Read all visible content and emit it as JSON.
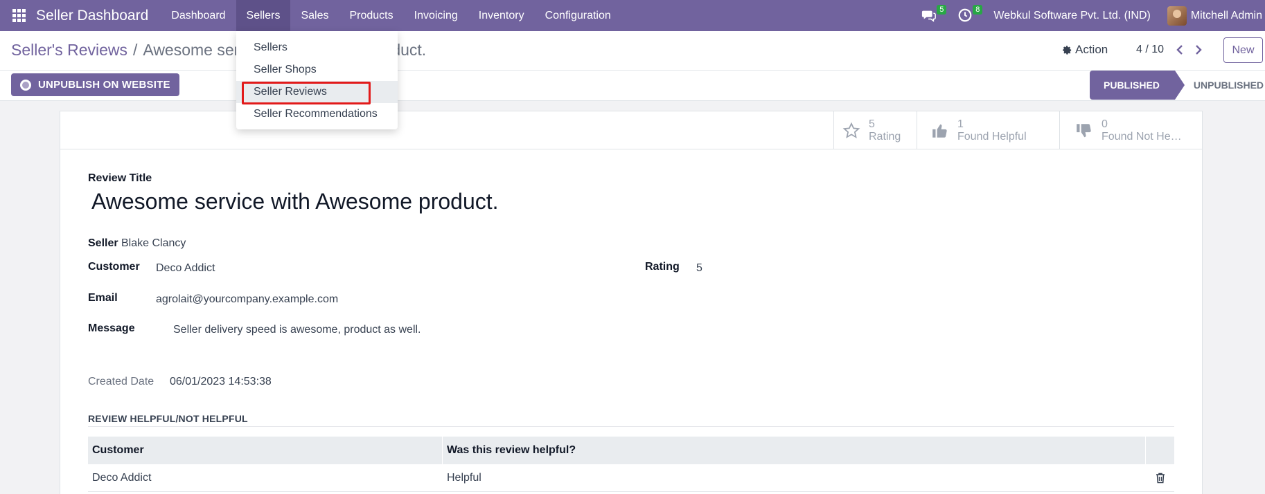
{
  "navbar": {
    "brand": "Seller Dashboard",
    "menu": [
      "Dashboard",
      "Sellers",
      "Sales",
      "Products",
      "Invoicing",
      "Inventory",
      "Configuration"
    ],
    "messages_count": "5",
    "activities_count": "8",
    "company": "Webkul Software Pvt. Ltd. (IND)",
    "user": "Mitchell Admin"
  },
  "dropdown": {
    "items": [
      "Sellers",
      "Seller Shops",
      "Seller Reviews",
      "Seller Recommendations"
    ],
    "highlighted": "Seller Reviews"
  },
  "breadcrumb": {
    "parent": "Seller's Reviews",
    "separator": "/",
    "current_visible_start": "Awesome ser",
    "current_visible_end": "duct."
  },
  "control": {
    "action_label": "Action",
    "pager": "4 / 10",
    "new_label": "New",
    "unpublish_label": "UNPUBLISH ON WEBSITE",
    "status_published": "PUBLISHED",
    "status_unpublished": "UNPUBLISHED"
  },
  "stats": {
    "rating_value": "5",
    "rating_label": "Rating",
    "helpful_value": "1",
    "helpful_label": "Found Helpful",
    "not_helpful_value": "0",
    "not_helpful_label": "Found Not He…"
  },
  "form": {
    "review_title_label": "Review Title",
    "review_title": "Awesome service with Awesome product.",
    "seller_label": "Seller",
    "seller": "Blake Clancy",
    "customer_label": "Customer",
    "customer": "Deco Addict",
    "rating_label": "Rating",
    "rating": "5",
    "email_label": "Email",
    "email": "agrolait@yourcompany.example.com",
    "message_label": "Message",
    "message": "Seller delivery speed is awesome, product as well.",
    "created_label": "Created Date",
    "created": "06/01/2023 14:53:38"
  },
  "helpful_section": {
    "title": "REVIEW HELPFUL/NOT HELPFUL",
    "columns": [
      "Customer",
      "Was this review helpful?"
    ],
    "rows": [
      {
        "customer": "Deco Addict",
        "helpful": "Helpful"
      }
    ]
  },
  "colors": {
    "brand": "#71639e",
    "highlight": "#e21a1a",
    "badge": "#28a745"
  }
}
